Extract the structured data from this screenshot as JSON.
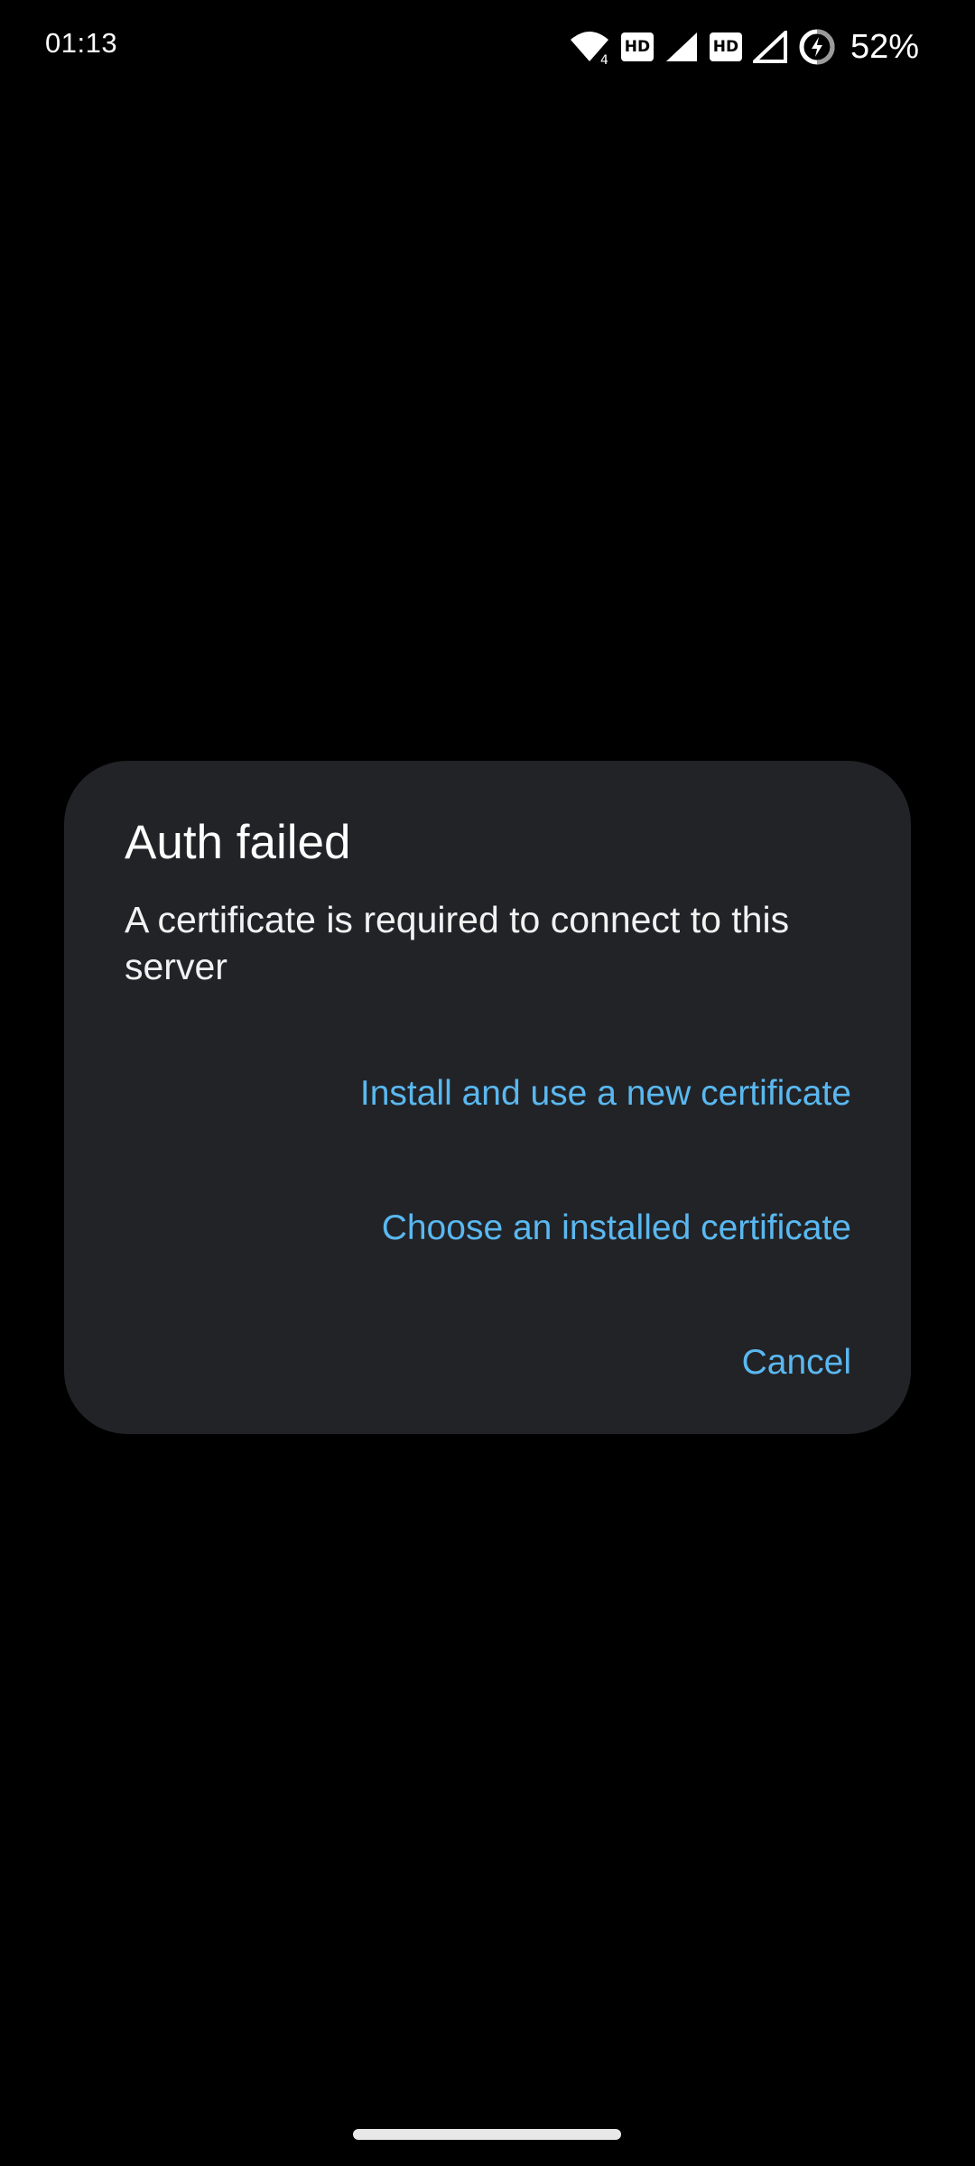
{
  "status_bar": {
    "time": "01:13",
    "battery_percent": "52%",
    "wifi_badge": "4",
    "hd_label": "HD",
    "icons": [
      "wifi-icon",
      "hd-icon",
      "signal-icon",
      "hd-icon",
      "signal-icon",
      "battery-charging-icon"
    ]
  },
  "dialog": {
    "title": "Auth failed",
    "message": "A certificate is required to connect to this server",
    "actions": {
      "install": "Install and use a new certificate",
      "choose": "Choose an installed certificate",
      "cancel": "Cancel"
    }
  },
  "colors": {
    "background": "#000000",
    "dialog_surface": "#222327",
    "accent": "#5ab8f0",
    "text": "#ffffff"
  }
}
